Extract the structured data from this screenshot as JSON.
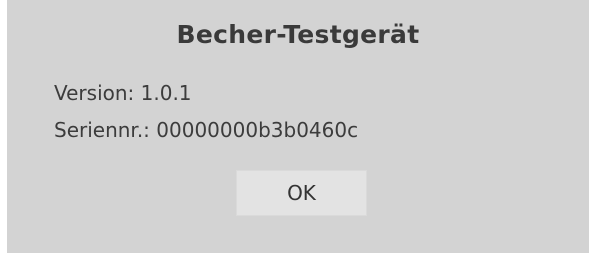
{
  "dialog": {
    "title": "Becher-Testgerät",
    "version_line": "Version: 1.0.1",
    "serial_line": "Seriennr.: 00000000b3b0460c",
    "ok_label": "OK"
  },
  "colors": {
    "dialog_background": "#d3d3d3",
    "button_background": "#e3e3e3",
    "text": "#333333"
  }
}
